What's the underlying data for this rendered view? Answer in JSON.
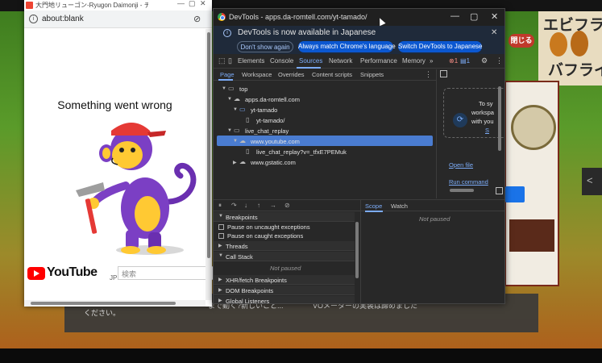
{
  "background": {
    "close_button": "閉じる",
    "ebi_text_top": "エビフライ",
    "ebi_text_bottom": "バフライ",
    "panel_line1a": "まで動く?新しいこと...",
    "panel_line1b": "VOメーターの実装は諦めました",
    "panel_line2": "ください。",
    "right_chevron": "<"
  },
  "popup": {
    "window_title": "大門地リューゴン-Ryugon Daimonji - チャット -...",
    "address": "about:blank",
    "error_heading": "Something went wrong",
    "youtube_logo": "YouTube",
    "youtube_region": "JP",
    "search_placeholder": "検索"
  },
  "devtools": {
    "window_title": "DevTools - apps.da-romtell.com/yt-tamado/",
    "banner_message": "DevTools is now available in Japanese",
    "btn_dont_show": "Don't show again",
    "btn_match_lang": "Always match Chrome's language",
    "btn_switch": "Switch DevTools to Japanese",
    "tabs": [
      "Elements",
      "Console",
      "Sources",
      "Network",
      "Performance",
      "Memory"
    ],
    "more_tabs": "»",
    "error_count": "1",
    "message_count": "1",
    "sub_tabs": [
      "Page",
      "Workspace",
      "Overrides",
      "Content scripts",
      "Snippets"
    ],
    "tree": {
      "top": "top",
      "apps": "apps.da-romtell.com",
      "yt_tamado": "yt-tamado",
      "yt_tamado_file": "yt-tamado/",
      "live_chat_replay": "live_chat_replay",
      "youtube": "www.youtube.com",
      "live_chat_file": "live_chat_replay?v=_tfxE7PEMuk",
      "gstatic": "www.gstatic.com"
    },
    "right_pane": {
      "to_sync": "To sy",
      "workspace": "workspa",
      "with_you": "with you",
      "link_s": "S",
      "open_file": "Open file",
      "run_command": "Run command"
    },
    "debugger": {
      "breakpoints": "Breakpoints",
      "pause_uncaught": "Pause on uncaught exceptions",
      "pause_caught": "Pause on caught exceptions",
      "threads": "Threads",
      "call_stack": "Call Stack",
      "not_paused": "Not paused",
      "xhr_breakpoints": "XHR/fetch Breakpoints",
      "dom_breakpoints": "DOM Breakpoints",
      "global_listeners": "Global Listeners"
    },
    "scope": {
      "scope_tab": "Scope",
      "watch_tab": "Watch",
      "not_paused": "Not paused"
    }
  },
  "colors": {
    "accent": "#7cacf8",
    "selected_row": "#4a7cd0",
    "youtube_red": "#ff0000"
  }
}
